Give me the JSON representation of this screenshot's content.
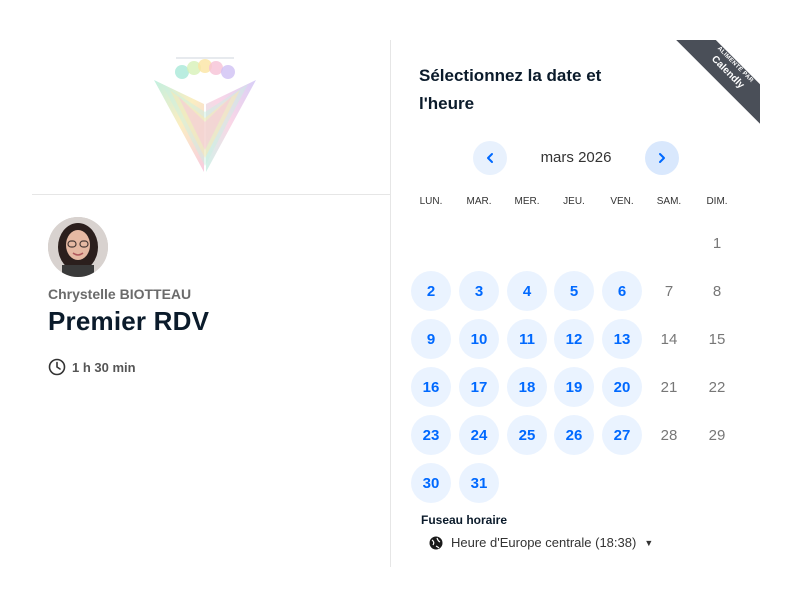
{
  "logo": {
    "icon": "calendly-host-logo"
  },
  "host": {
    "name": "Chrystelle BIOTTEAU"
  },
  "event": {
    "title": "Premier RDV",
    "duration": "1 h 30 min"
  },
  "scheduler": {
    "title": "Sélectionnez la date et l'heure",
    "month": "mars 2026",
    "weekdays": [
      "LUN.",
      "MAR.",
      "MER.",
      "JEU.",
      "VEN.",
      "SAM.",
      "DIM."
    ],
    "days": [
      {
        "d": "1",
        "a": false
      },
      {
        "d": "2",
        "a": true
      },
      {
        "d": "3",
        "a": true
      },
      {
        "d": "4",
        "a": true
      },
      {
        "d": "5",
        "a": true
      },
      {
        "d": "6",
        "a": true
      },
      {
        "d": "7",
        "a": false
      },
      {
        "d": "8",
        "a": false
      },
      {
        "d": "9",
        "a": true
      },
      {
        "d": "10",
        "a": true
      },
      {
        "d": "11",
        "a": true
      },
      {
        "d": "12",
        "a": true
      },
      {
        "d": "13",
        "a": true
      },
      {
        "d": "14",
        "a": false
      },
      {
        "d": "15",
        "a": false
      },
      {
        "d": "16",
        "a": true
      },
      {
        "d": "17",
        "a": true
      },
      {
        "d": "18",
        "a": true
      },
      {
        "d": "19",
        "a": true
      },
      {
        "d": "20",
        "a": true
      },
      {
        "d": "21",
        "a": false
      },
      {
        "d": "22",
        "a": false
      },
      {
        "d": "23",
        "a": true
      },
      {
        "d": "24",
        "a": true
      },
      {
        "d": "25",
        "a": true
      },
      {
        "d": "26",
        "a": true
      },
      {
        "d": "27",
        "a": true
      },
      {
        "d": "28",
        "a": false
      },
      {
        "d": "29",
        "a": false
      },
      {
        "d": "30",
        "a": true
      },
      {
        "d": "31",
        "a": true
      }
    ],
    "timezone_label": "Fuseau horaire",
    "timezone": "Heure d'Europe centrale (18:38)"
  },
  "badge": {
    "small": "ALIMENTÉ PAR",
    "brand": "Calendly"
  },
  "colors": {
    "accent": "#0069ff",
    "available_bg": "#eaf3ff",
    "ribbon": "#4a4f58"
  }
}
